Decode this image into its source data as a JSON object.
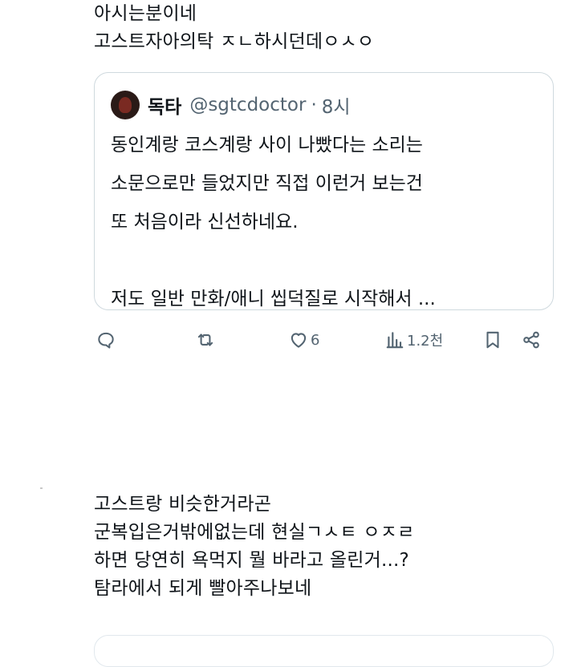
{
  "tweet1": {
    "lines": [
      "아시는분이네",
      "고스트자아의탁 ㅈㄴ하시던데ㅇㅅㅇ"
    ]
  },
  "quote": {
    "name": "독타",
    "handle": "@sgtcdoctor",
    "separator": "·",
    "time": "8시",
    "lines": [
      "동인계랑 코스계랑 사이 나빴다는 소리는",
      "소문으로만 들었지만 직접 이런거 보는건",
      "또 처음이라 신선하네요.",
      "",
      "저도 일반 만화/애니 씹덕질로 시작해서 ..."
    ]
  },
  "actions": {
    "likes": "6",
    "views": "1.2천"
  },
  "icons": {
    "reply": "reply-icon",
    "retweet": "retweet-icon",
    "like": "heart-icon",
    "views": "views-icon",
    "bookmark": "bookmark-icon",
    "share": "share-icon"
  },
  "tweet2": {
    "lines": [
      "고스트랑 비슷한거라곤",
      "군복입은거밖에없는데 현실ㄱㅅㅌ ㅇㅈㄹ",
      "하면 당연히 욕먹지 뭘 바라고 올린거...?",
      "탐라에서 되게 빨아주나보네"
    ]
  },
  "colors": {
    "text": "#0f1419",
    "secondary": "#536471",
    "border": "#cfd9de"
  }
}
